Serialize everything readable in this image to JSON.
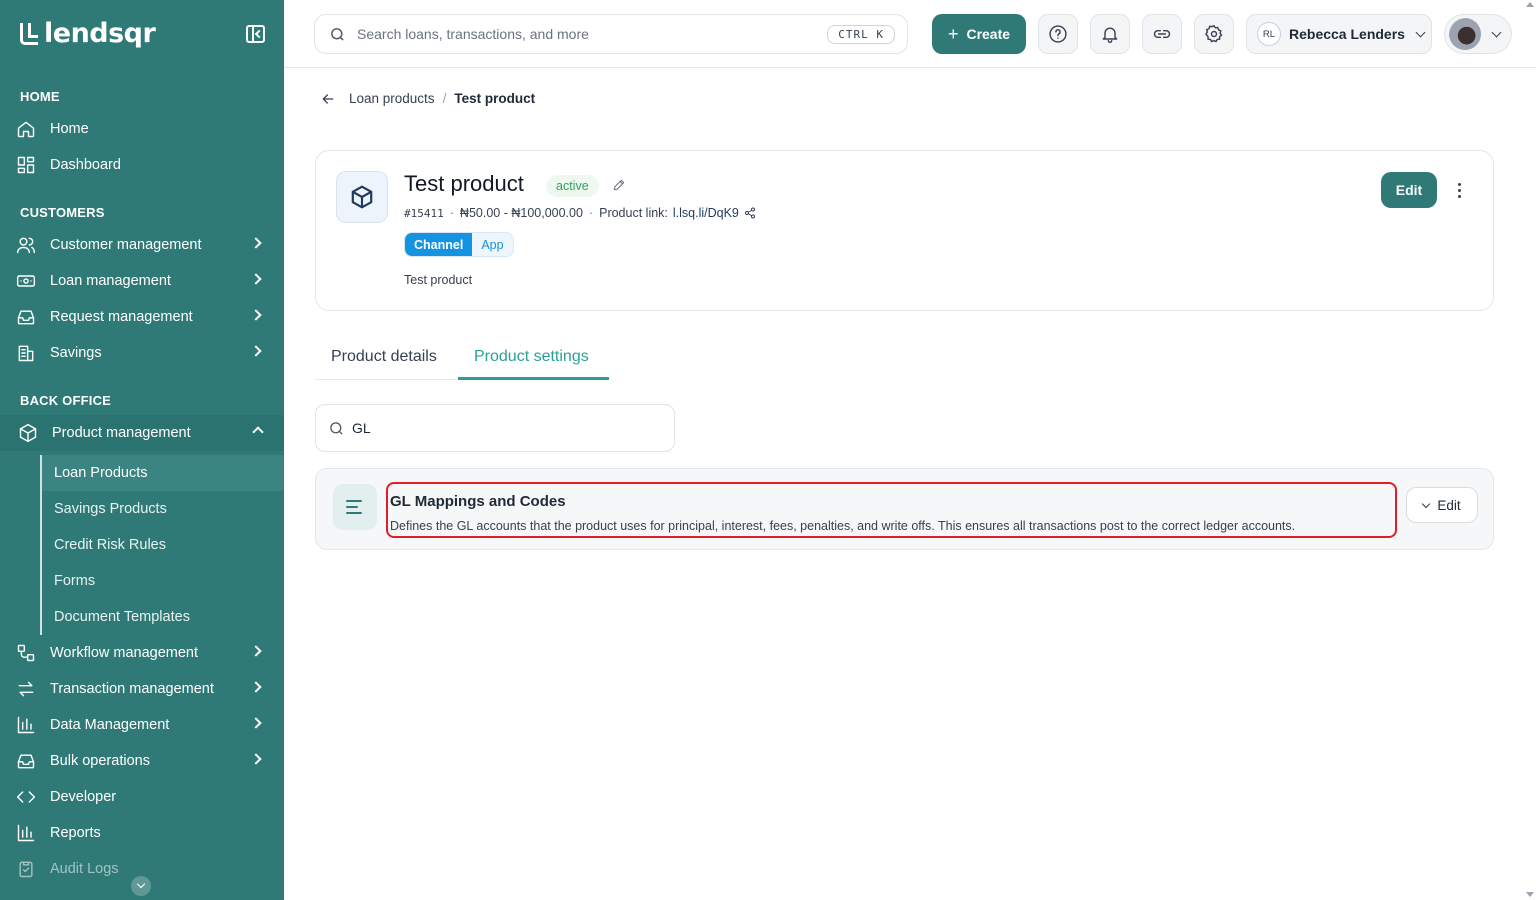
{
  "app": {
    "brand": "lendsqr"
  },
  "colors": {
    "sidebar": "#2f7a77",
    "accent": "#2aa198",
    "highlight": "#e01e2b",
    "status_active": "#2fa35f",
    "channel": "#1493e0"
  },
  "sidebar": {
    "sections": [
      {
        "title": "HOME"
      },
      {
        "title": "CUSTOMERS"
      },
      {
        "title": "BACK OFFICE"
      }
    ],
    "items": {
      "home": "Home",
      "dashboard": "Dashboard",
      "customer_management": "Customer management",
      "loan_management": "Loan management",
      "request_management": "Request management",
      "savings": "Savings",
      "product_management": "Product management",
      "workflow_management": "Workflow management",
      "transaction_management": "Transaction management",
      "data_management": "Data Management",
      "bulk_operations": "Bulk operations",
      "developer": "Developer",
      "reports": "Reports",
      "audit_logs": "Audit Logs"
    },
    "product_sub": [
      "Loan Products",
      "Savings Products",
      "Credit Risk Rules",
      "Forms",
      "Document Templates"
    ]
  },
  "topbar": {
    "search_placeholder": "Search loans, transactions, and more",
    "shortcut": "CTRL K",
    "create_label": "Create",
    "user_initials": "RL",
    "user_name": "Rebecca Lenders"
  },
  "breadcrumb": {
    "parent": "Loan products",
    "separator": "/",
    "current": "Test product"
  },
  "product": {
    "title": "Test product",
    "status": "active",
    "id": "#15411",
    "range": "₦50.00 - ₦100,000.00",
    "link_label": "Product link:",
    "link": "l.lsq.li/DqK9",
    "channel_key": "Channel",
    "channel_value": "App",
    "description": "Test product",
    "edit_label": "Edit"
  },
  "tabs": {
    "details": "Product details",
    "settings": "Product settings",
    "active": "settings"
  },
  "filter": {
    "value": "GL"
  },
  "settings_row": {
    "title": "GL Mappings and Codes",
    "description": "Defines the GL accounts that the product uses for principal, interest, fees, penalties, and write offs. This ensures all transactions post to the correct ledger accounts.",
    "edit_label": "Edit"
  }
}
